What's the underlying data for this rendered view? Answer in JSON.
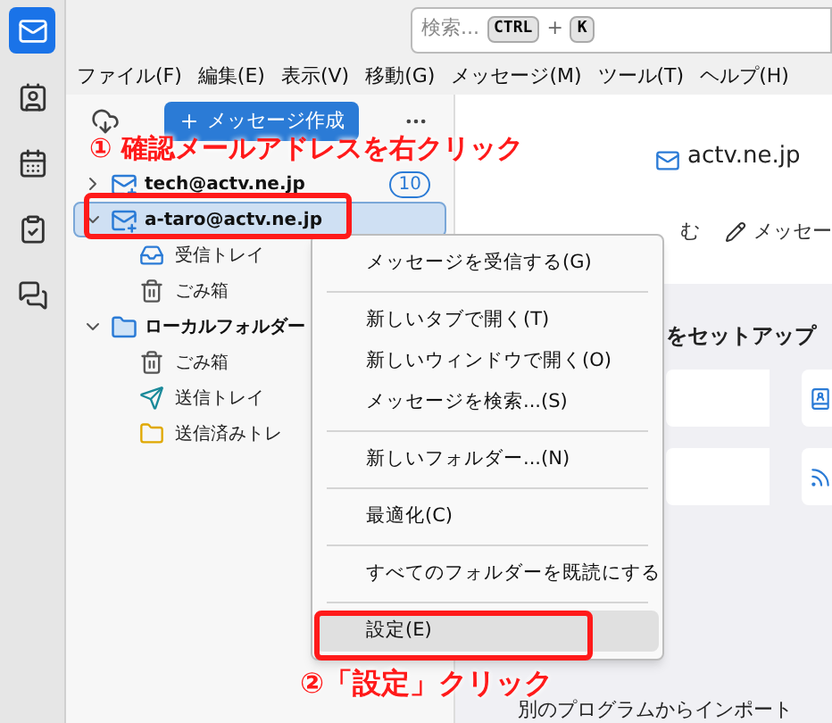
{
  "rail": [
    {
      "kind": "mail",
      "selected": true
    },
    {
      "kind": "contacts",
      "selected": false
    },
    {
      "kind": "calendar",
      "selected": false
    },
    {
      "kind": "tasks",
      "selected": false
    },
    {
      "kind": "chat",
      "selected": false
    }
  ],
  "search": {
    "placeholder": "検索...",
    "keys": [
      "CTRL",
      "K"
    ],
    "joiner": "+"
  },
  "menubar": [
    "ファイル(F)",
    "編集(E)",
    "表示(V)",
    "移動(G)",
    "メッセージ(M)",
    "ツール(T)",
    "ヘルプ(H)"
  ],
  "folder_pane": {
    "compose_button": "メッセージ作成",
    "tree": [
      {
        "label": "tech@actv.ne.jp",
        "kind": "account",
        "expanded": false,
        "selected": false,
        "badge": "10"
      },
      {
        "label": "a-taro@actv.ne.jp",
        "kind": "account",
        "expanded": true,
        "selected": true,
        "children": [
          {
            "label": "受信トレイ",
            "kind": "inbox"
          },
          {
            "label": "ごみ箱",
            "kind": "trash"
          }
        ]
      },
      {
        "label": "ローカルフォルダー",
        "kind": "local",
        "expanded": true,
        "selected": false,
        "children": [
          {
            "label": "ごみ箱",
            "kind": "trash"
          },
          {
            "label": "送信トレイ",
            "kind": "outbox"
          },
          {
            "label": "送信済みトレ",
            "kind": "folder"
          }
        ]
      }
    ]
  },
  "content": {
    "account_header": "actv.ne.jp",
    "toolbar": [
      {
        "label": "む",
        "kind": "text"
      },
      {
        "label": "メッセー",
        "kind": "pencil"
      }
    ],
    "setup_title": "をセットアップ",
    "import_title": "別のプログラムからインポート"
  },
  "context_menu": [
    {
      "kind": "item",
      "label": "メッセージを受信する(G)",
      "selected": false
    },
    {
      "kind": "separator"
    },
    {
      "kind": "item",
      "label": "新しいタブで開く(T)",
      "selected": false
    },
    {
      "kind": "item",
      "label": "新しいウィンドウで開く(O)",
      "selected": false
    },
    {
      "kind": "item",
      "label": "メッセージを検索...(S)",
      "selected": false
    },
    {
      "kind": "separator"
    },
    {
      "kind": "item",
      "label": "新しいフォルダー...(N)",
      "selected": false
    },
    {
      "kind": "separator"
    },
    {
      "kind": "item",
      "label": "最適化(C)",
      "selected": false
    },
    {
      "kind": "separator"
    },
    {
      "kind": "item",
      "label": "すべてのフォルダーを既読にする",
      "selected": false
    },
    {
      "kind": "separator"
    },
    {
      "kind": "item",
      "label": "設定(E)",
      "selected": true
    }
  ],
  "annotations": [
    {
      "text": "① 確認メールアドレスを右クリック"
    },
    {
      "text": "②「設定」クリック"
    }
  ]
}
